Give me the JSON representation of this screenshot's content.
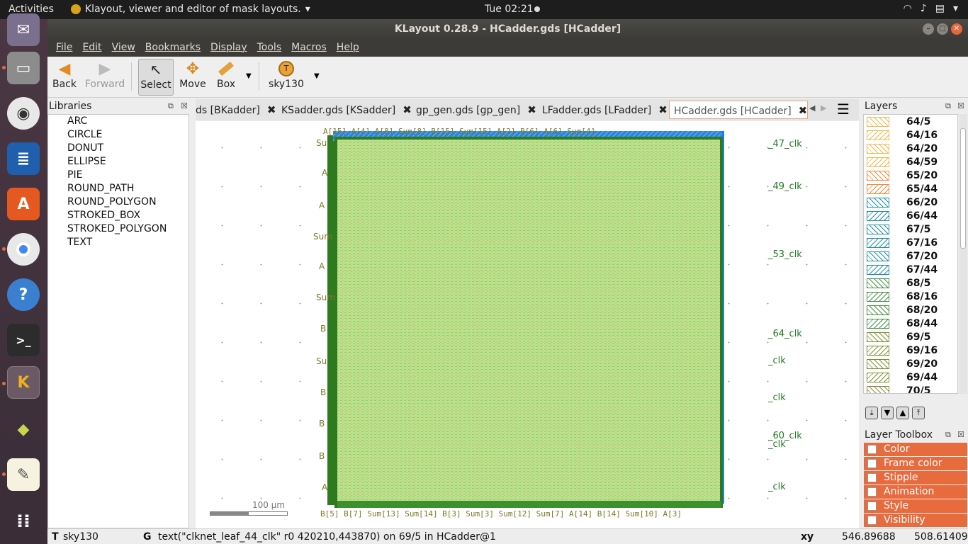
{
  "topbar": {
    "activities": "Activities",
    "app_menu": "Klayout, viewer and editor of mask layouts.",
    "clock": "Tue 02:21"
  },
  "window": {
    "title": "KLayout 0.28.9 - HCadder.gds [HCadder]"
  },
  "menu": [
    "File",
    "Edit",
    "View",
    "Bookmarks",
    "Display",
    "Tools",
    "Macros",
    "Help"
  ],
  "toolbar": {
    "back": "Back",
    "forward": "Forward",
    "select": "Select",
    "move": "Move",
    "box": "Box",
    "tech": "sky130"
  },
  "libraries": {
    "title": "Libraries",
    "items": [
      "ARC",
      "CIRCLE",
      "DONUT",
      "ELLIPSE",
      "PIE",
      "ROUND_PATH",
      "ROUND_POLYGON",
      "STROKED_BOX",
      "STROKED_POLYGON",
      "TEXT"
    ]
  },
  "tabs": [
    "ds [BKadder]",
    "KSadder.gds [KSadder]",
    "gp_gen.gds [gp_gen]",
    "LFadder.gds [LFadder]",
    "HCadder.gds [HCadder]"
  ],
  "canvas": {
    "scale_label": "100 µm",
    "right_labels": [
      "_47_clk",
      "_49_clk",
      "_53_clk",
      "_64_clk",
      "_clk",
      "_clk",
      "_60_clk",
      "_clk",
      "_clk"
    ],
    "left_labels": [
      "Su",
      "A",
      "A",
      "Sum",
      "A",
      "Sum",
      "B",
      "Su",
      "B",
      "B",
      "B",
      "A"
    ],
    "top_text": "A[15] A[4] A[8] Sum[8] B[15] Sum[15] A[2] B[6] A[6] Sum[4]",
    "bottom_text": "B[5] B[7] Sum[13] Sum[14] B[3] Sum[3] Sum[12] Sum[7] A[14] B[14] Sum[10] A[3]"
  },
  "layers": {
    "title": "Layers",
    "items": [
      {
        "name": "64/5",
        "color": "#f2b84b"
      },
      {
        "name": "64/16",
        "color": "#f2b84b"
      },
      {
        "name": "64/20",
        "color": "#f2b84b"
      },
      {
        "name": "64/59",
        "color": "#f2b84b"
      },
      {
        "name": "65/20",
        "color": "#f08a3c"
      },
      {
        "name": "65/44",
        "color": "#f08a3c"
      },
      {
        "name": "66/20",
        "color": "#1e8fa8"
      },
      {
        "name": "66/44",
        "color": "#1e8fa8"
      },
      {
        "name": "67/5",
        "color": "#1e8fa8"
      },
      {
        "name": "67/16",
        "color": "#1e8fa8"
      },
      {
        "name": "67/20",
        "color": "#1e8fa8"
      },
      {
        "name": "67/44",
        "color": "#1e8fa8"
      },
      {
        "name": "68/5",
        "color": "#3e8f3e"
      },
      {
        "name": "68/16",
        "color": "#3e8f3e"
      },
      {
        "name": "68/20",
        "color": "#3e8f3e"
      },
      {
        "name": "68/44",
        "color": "#3e8f3e"
      },
      {
        "name": "69/5",
        "color": "#7a8f2e"
      },
      {
        "name": "69/16",
        "color": "#7a8f2e"
      },
      {
        "name": "69/20",
        "color": "#7a8f2e"
      },
      {
        "name": "69/44",
        "color": "#7a8f2e"
      },
      {
        "name": "70/5",
        "color": "#8a8a3a"
      }
    ]
  },
  "toolbox": {
    "title": "Layer Toolbox",
    "items": [
      "Color",
      "Frame color",
      "Stipple",
      "Animation",
      "Style",
      "Visibility"
    ]
  },
  "status": {
    "tech_label": "T",
    "tech": "sky130",
    "g_label": "G",
    "message": "text(\"clknet_leaf_44_clk\" r0 420210,443870) on 69/5 in HCadder@1",
    "xy_label": "xy",
    "x": "546.89688",
    "y": "508.61409"
  }
}
